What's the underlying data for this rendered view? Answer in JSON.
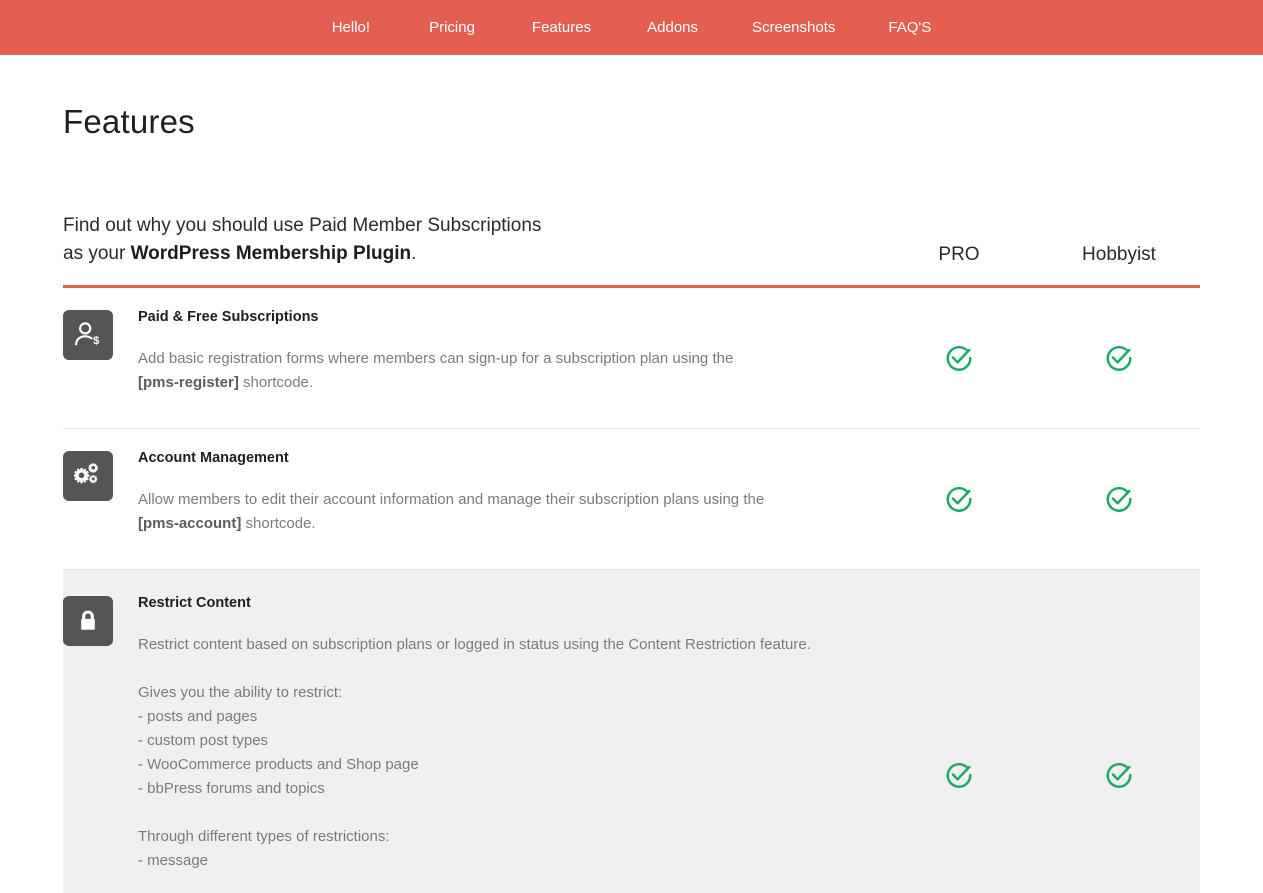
{
  "nav": {
    "items": [
      {
        "label": "Hello!",
        "name": "nav-item-hello"
      },
      {
        "label": "Pricing",
        "name": "nav-item-pricing"
      },
      {
        "label": "Features",
        "name": "nav-item-features"
      },
      {
        "label": "Addons",
        "name": "nav-item-addons"
      },
      {
        "label": "Screenshots",
        "name": "nav-item-screenshots"
      },
      {
        "label": "FAQ'S",
        "name": "nav-item-faqs"
      }
    ],
    "background": "#e45f52",
    "text_color": "#ffffff"
  },
  "page": {
    "title": "Features"
  },
  "table": {
    "intro_line1": "Find out why you should use Paid Member Subscriptions",
    "intro_line2_prefix": "as your ",
    "intro_line2_bold": "WordPress Membership Plugin",
    "intro_line2_suffix": ".",
    "columns": [
      {
        "label": "PRO"
      },
      {
        "label": "Hobbyist"
      }
    ],
    "accent_color": "#e45f52",
    "check_color": "#20a763",
    "rows": [
      {
        "icon": "user-dollar-icon",
        "name": "Paid & Free Subscriptions",
        "desc_prefix": "Add basic registration forms where members can sign-up for a subscription plan using the\n",
        "desc_code": "[pms-register]",
        "desc_suffix": " shortcode.",
        "pro": "check",
        "hobbyist": "check",
        "shaded": false
      },
      {
        "icon": "gears-icon",
        "name": "Account Management",
        "desc_prefix": "Allow members to edit their account information and manage their subscription plans using the\n",
        "desc_code": "[pms-account]",
        "desc_suffix": " shortcode.",
        "pro": "check",
        "hobbyist": "check",
        "shaded": false
      },
      {
        "icon": "lock-icon",
        "name": "Restrict Content",
        "desc_prefix": "Restrict content based on subscription plans or logged in status using the Content Restriction feature.\n\nGives you the ability to restrict:\n- posts and pages\n- custom post types\n- WooCommerce products and Shop page\n- bbPress forums and topics\n\nThrough different types of restrictions:\n- message",
        "desc_code": "",
        "desc_suffix": "",
        "pro": "check",
        "hobbyist": "check",
        "shaded": true
      }
    ]
  }
}
